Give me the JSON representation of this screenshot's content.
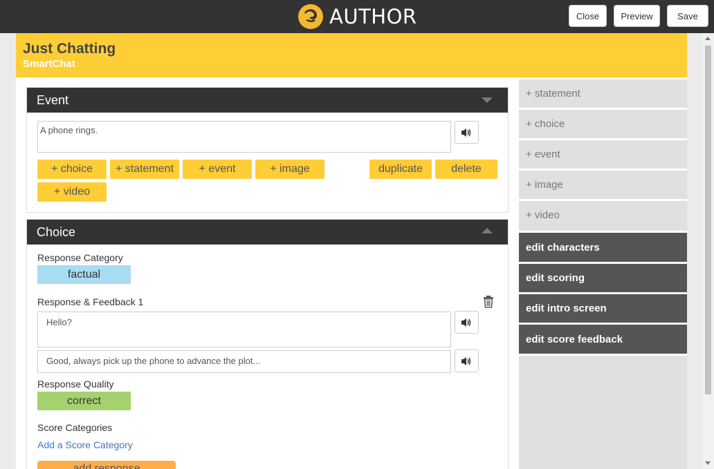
{
  "app": {
    "brand": "AUTHOR",
    "close_label": "Close",
    "preview_label": "Preview",
    "save_label": "Save"
  },
  "header": {
    "title": "Just Chatting",
    "subtitle": "SmartChat"
  },
  "event_panel": {
    "title": "Event",
    "text": "A phone rings.",
    "buttons": {
      "choice": "+ choice",
      "statement": "+ statement",
      "event": "+ event",
      "image": "+ image",
      "duplicate": "duplicate",
      "delete": "delete",
      "video": "+ video"
    }
  },
  "choice_panel": {
    "title": "Choice",
    "response_category_label": "Response Category",
    "response_category_value": "factual",
    "response_feedback_label": "Response & Feedback 1",
    "response_text": "Hello?",
    "feedback_text": "Good, always pick up the phone to advance the plot...",
    "response_quality_label": "Response Quality",
    "response_quality_value": "correct",
    "score_categories_label": "Score Categories",
    "add_score_category_link": "Add a Score Category",
    "add_response_label": "add response"
  },
  "sidebar": {
    "add_items": [
      "+ statement",
      "+ choice",
      "+ event",
      "+ image",
      "+ video"
    ],
    "edit_items": [
      "edit characters",
      "edit scoring",
      "edit intro screen",
      "edit score feedback"
    ]
  },
  "colors": {
    "accent_yellow": "#ffcd36",
    "dark_bar": "#333333",
    "factual_pill": "#a7dcf3",
    "correct_pill": "#a6d16f",
    "add_response": "#ffad4b",
    "link": "#3a7bbf"
  },
  "icons": [
    "logo-icon",
    "speaker-icon",
    "trash-icon",
    "caret-down-icon",
    "caret-up-icon"
  ]
}
